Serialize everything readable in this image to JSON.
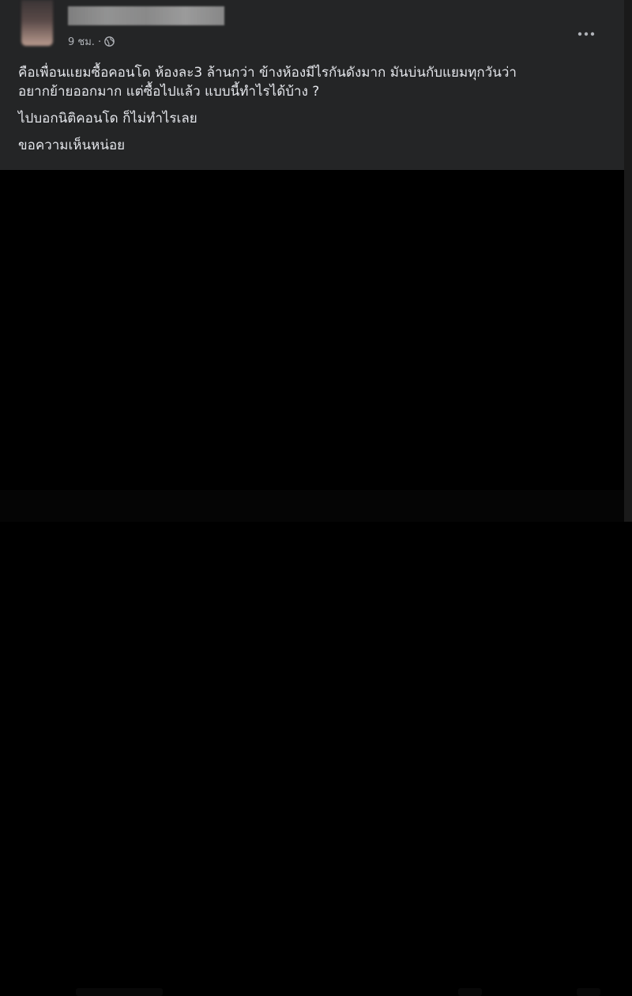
{
  "post": {
    "time": "9 ชม. ·",
    "privacy_icon": "globe-icon",
    "more_icon": "more-horizontal-icon",
    "paragraphs": [
      "คือเพื่อนแยมซื้อคอนโด ห้องละ3 ล้านกว่า ข้างห้องมีไรกันดังมาก มันบ่นกับแยมทุกวันว่า\nอยากย้ายออกมาก แต่ซื้อไปแล้ว แบบนี้ทำไรได้บ้าง ?",
      "ไปบอกนิติคอนโด ก็ไม่ทำไรเลย",
      "ขอความเห็นหน่อย"
    ]
  },
  "colors": {
    "card_bg": "#242526",
    "text_primary": "#e4e6eb",
    "text_secondary": "#b0b3b8",
    "page_bg": "#000000"
  }
}
